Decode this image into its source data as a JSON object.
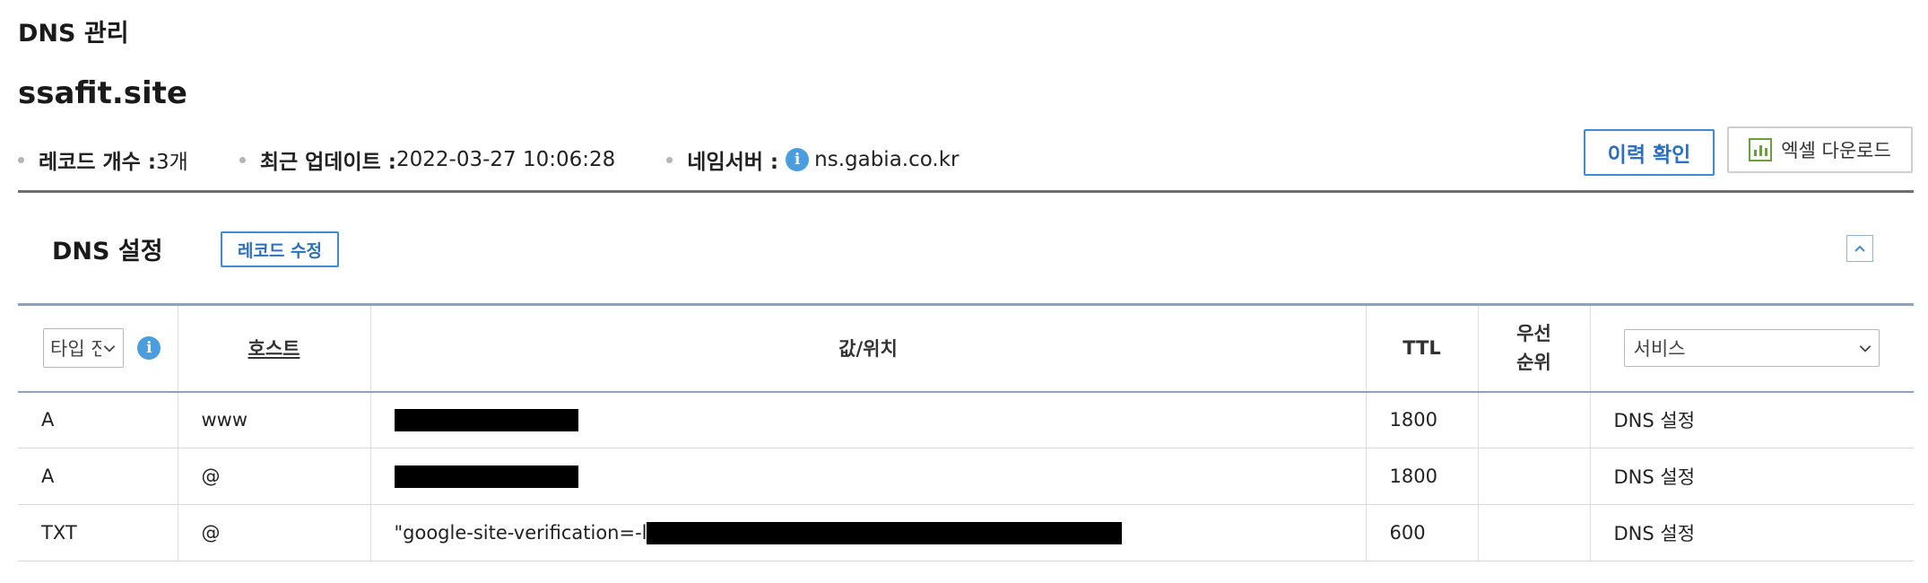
{
  "header": {
    "title": "DNS 관리",
    "domain": "ssafit.site"
  },
  "summary": {
    "record_count_label": "레코드 개수 : ",
    "record_count_value": "3개",
    "updated_label": "최근 업데이트 : ",
    "updated_value": "2022-03-27 10:06:28",
    "nameserver_label": "네임서버 : ",
    "nameserver_value": "ns.gabia.co.kr",
    "nameserver_icon": "info-icon"
  },
  "actions": {
    "history_label": "이력 확인",
    "excel_label": "엑셀 다운로드",
    "excel_icon": "bar-chart-icon"
  },
  "section": {
    "title": "DNS 설정",
    "edit_label": "레코드 수정",
    "collapse_icon": "chevron-up-icon"
  },
  "table": {
    "columns": {
      "type_select_value": "타입 전",
      "host": "호스트",
      "value": "값/위치",
      "ttl": "TTL",
      "priority_line1": "우선",
      "priority_line2": "순위",
      "service_select_value": "서비스"
    },
    "rows": [
      {
        "type": "A",
        "host": "www",
        "value_text": "",
        "value_redacted": true,
        "ttl": "1800",
        "priority": "",
        "service": "DNS 설정"
      },
      {
        "type": "A",
        "host": "@",
        "value_text": "",
        "value_redacted": true,
        "ttl": "1800",
        "priority": "",
        "service": "DNS 설정"
      },
      {
        "type": "TXT",
        "host": "@",
        "value_text": "\"google-site-verification=-l",
        "value_redacted": true,
        "ttl": "600",
        "priority": "",
        "service": "DNS 설정"
      }
    ]
  },
  "colors": {
    "accent_blue": "#3f8ad2",
    "info_blue": "#4a9ee0",
    "excel_green": "#6a9e3e",
    "table_border": "#8ea3b8"
  }
}
